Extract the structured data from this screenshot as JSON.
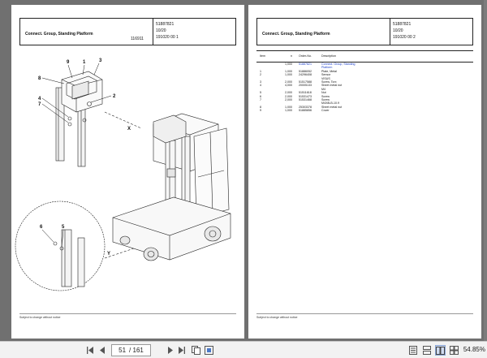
{
  "left_page": {
    "header_title": "Connect. Group, Standing Platform",
    "meta_1": "51887821",
    "meta_2": "10/20",
    "meta_3": "191020 00 1",
    "drawing_code": "116911",
    "footer": "Subject to change without notice",
    "callouts": [
      "9",
      "1",
      "3",
      "8",
      "2",
      "4",
      "7",
      "X",
      "6",
      "5",
      "Y"
    ]
  },
  "right_page": {
    "header_title": "Connect. Group, Standing Platform",
    "meta_1": "51887821",
    "meta_2": "10/20",
    "meta_3": "191020 00 2",
    "footer": "Subject to change without notice",
    "table": {
      "headers": [
        "Item",
        "n",
        "Order-No.",
        "Description"
      ],
      "rows": [
        {
          "item": "",
          "qty": "1,000",
          "order": "51887821",
          "desc": "Connect. Group, Standing",
          "highlight": true
        },
        {
          "item": "",
          "qty": "",
          "order": "",
          "desc": "Platform",
          "highlight": true
        },
        {
          "item": "1",
          "qty": "1,000",
          "order": "51886052",
          "desc": "Plate, Metal",
          "highlight": false
        },
        {
          "item": "2",
          "qty": "1,000",
          "order": "24296408",
          "desc": "Sensor",
          "highlight": false
        },
        {
          "item": "",
          "qty": "",
          "order": "",
          "desc": "VISUS",
          "highlight": false
        },
        {
          "item": "3",
          "qty": "2,000",
          "order": "51517588",
          "desc": "Screw, Torx",
          "highlight": false
        },
        {
          "item": "4",
          "qty": "4,000",
          "order": "20005133",
          "desc": "Sheet metal nut",
          "highlight": false
        },
        {
          "item": "",
          "qty": "",
          "order": "",
          "desc": "M4",
          "highlight": false
        },
        {
          "item": "5",
          "qty": "2,000",
          "order": "51511618",
          "desc": "Nut",
          "highlight": false
        },
        {
          "item": "6",
          "qty": "2,000",
          "order": "51531473",
          "desc": "Screw",
          "highlight": false
        },
        {
          "item": "7",
          "qty": "2,000",
          "order": "51531468",
          "desc": "Screw",
          "highlight": false
        },
        {
          "item": "",
          "qty": "",
          "order": "",
          "desc": "M4X8LB-10.9",
          "highlight": false
        },
        {
          "item": "8",
          "qty": "1,000",
          "order": "25303378",
          "desc": "Sheet metal nut",
          "highlight": false
        },
        {
          "item": "9",
          "qty": "1,000",
          "order": "51885856",
          "desc": "Cover",
          "highlight": false
        }
      ]
    }
  },
  "toolbar": {
    "current_page": "51",
    "page_total": "/ 161",
    "zoom": "54.85%",
    "icons": [
      "first-page-icon",
      "previous-page-icon",
      "next-page-icon",
      "last-page-icon",
      "fit-page-icon",
      "two-page-icon",
      "single-page-icon",
      "continuous-page-icon",
      "rotate-icon"
    ]
  }
}
